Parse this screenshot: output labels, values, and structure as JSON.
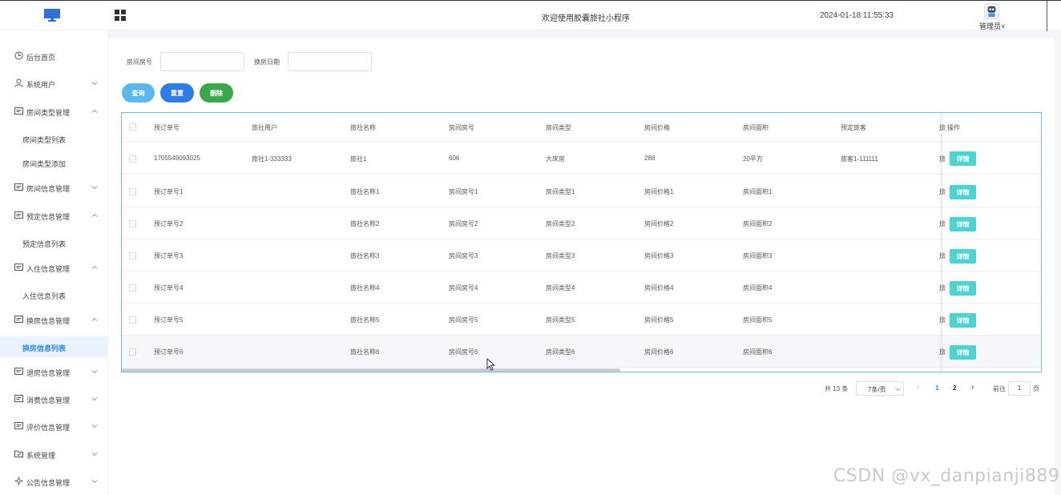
{
  "header": {
    "title": "欢迎使用胶囊旅社小程序",
    "datetime": "2024-01-18 11:55:33",
    "user": "管理员",
    "user_chevron": "˅"
  },
  "sidebar": {
    "items": [
      {
        "label": "后台首页",
        "icon": "clock-icon"
      },
      {
        "label": "系统用户",
        "icon": "user-icon"
      },
      {
        "label": "房间类型管理",
        "icon": "card-icon"
      },
      {
        "label": "房间类型列表"
      },
      {
        "label": "房间类型添加"
      },
      {
        "label": "房间信息管理",
        "icon": "card-icon"
      },
      {
        "label": "预定信息管理",
        "icon": "card-icon"
      },
      {
        "label": "预定信息列表"
      },
      {
        "label": "入住信息管理",
        "icon": "card-icon"
      },
      {
        "label": "入住信息列表"
      },
      {
        "label": "换房信息管理",
        "icon": "card-icon"
      },
      {
        "label": "换房信息列表"
      },
      {
        "label": "退房信息管理",
        "icon": "card-icon"
      },
      {
        "label": "消费信息管理",
        "icon": "card-icon"
      },
      {
        "label": "评价信息管理",
        "icon": "card-icon"
      },
      {
        "label": "系统管理",
        "icon": "folder-icon"
      },
      {
        "label": "公告信息管理",
        "icon": "sparkle-icon"
      }
    ]
  },
  "search": {
    "room_no_label": "房间房号",
    "room_no_value": "",
    "date_label": "换房日期",
    "date_value": ""
  },
  "buttons": {
    "query": "查询",
    "reset": "重置",
    "delete": "删除"
  },
  "table": {
    "columns": [
      "预订单号",
      "旅社用户",
      "旅社名称",
      "房间房号",
      "房间类型",
      "房间价格",
      "房间面积",
      "预定旅客",
      "旅",
      "操作"
    ],
    "rows": [
      [
        "1705549093025",
        "旅社1-333333",
        "旅社1",
        "606",
        "大床房",
        "288",
        "20平方",
        "旅客1-111111",
        "旅"
      ],
      [
        "预订单号1",
        "",
        "旅社名称1",
        "房间房号1",
        "房间类型1",
        "房间价格1",
        "房间面积1",
        "",
        "旅"
      ],
      [
        "预订单号2",
        "",
        "旅社名称2",
        "房间房号2",
        "房间类型2",
        "房间价格2",
        "房间面积2",
        "",
        "旅"
      ],
      [
        "预订单号3",
        "",
        "旅社名称3",
        "房间房号3",
        "房间类型3",
        "房间价格3",
        "房间面积3",
        "",
        "旅"
      ],
      [
        "预订单号4",
        "",
        "旅社名称4",
        "房间房号4",
        "房间类型4",
        "房间价格4",
        "房间面积4",
        "",
        "旅"
      ],
      [
        "预订单号5",
        "",
        "旅社名称5",
        "房间房号5",
        "房间类型5",
        "房间价格5",
        "房间面积5",
        "",
        "旅"
      ],
      [
        "预订单号6",
        "",
        "旅社名称6",
        "房间房号6",
        "房间类型6",
        "房间价格6",
        "房间面积6",
        "",
        "旅"
      ]
    ],
    "detail_label": "详情"
  },
  "pagination": {
    "total": "共 13 条",
    "page_size": "7条/页",
    "prev": "‹",
    "pages": [
      "1",
      "2"
    ],
    "next": "›",
    "goto_label": "前往",
    "goto_value": "1",
    "goto_unit": "页"
  },
  "watermark": "CSDN @vx_danpianji889",
  "colors": {
    "query": "#5bb8ee",
    "reset": "#2f7be7",
    "delete": "#3aa84a",
    "detail": "#4fd3d1",
    "active_menu": "#2f86ee"
  }
}
